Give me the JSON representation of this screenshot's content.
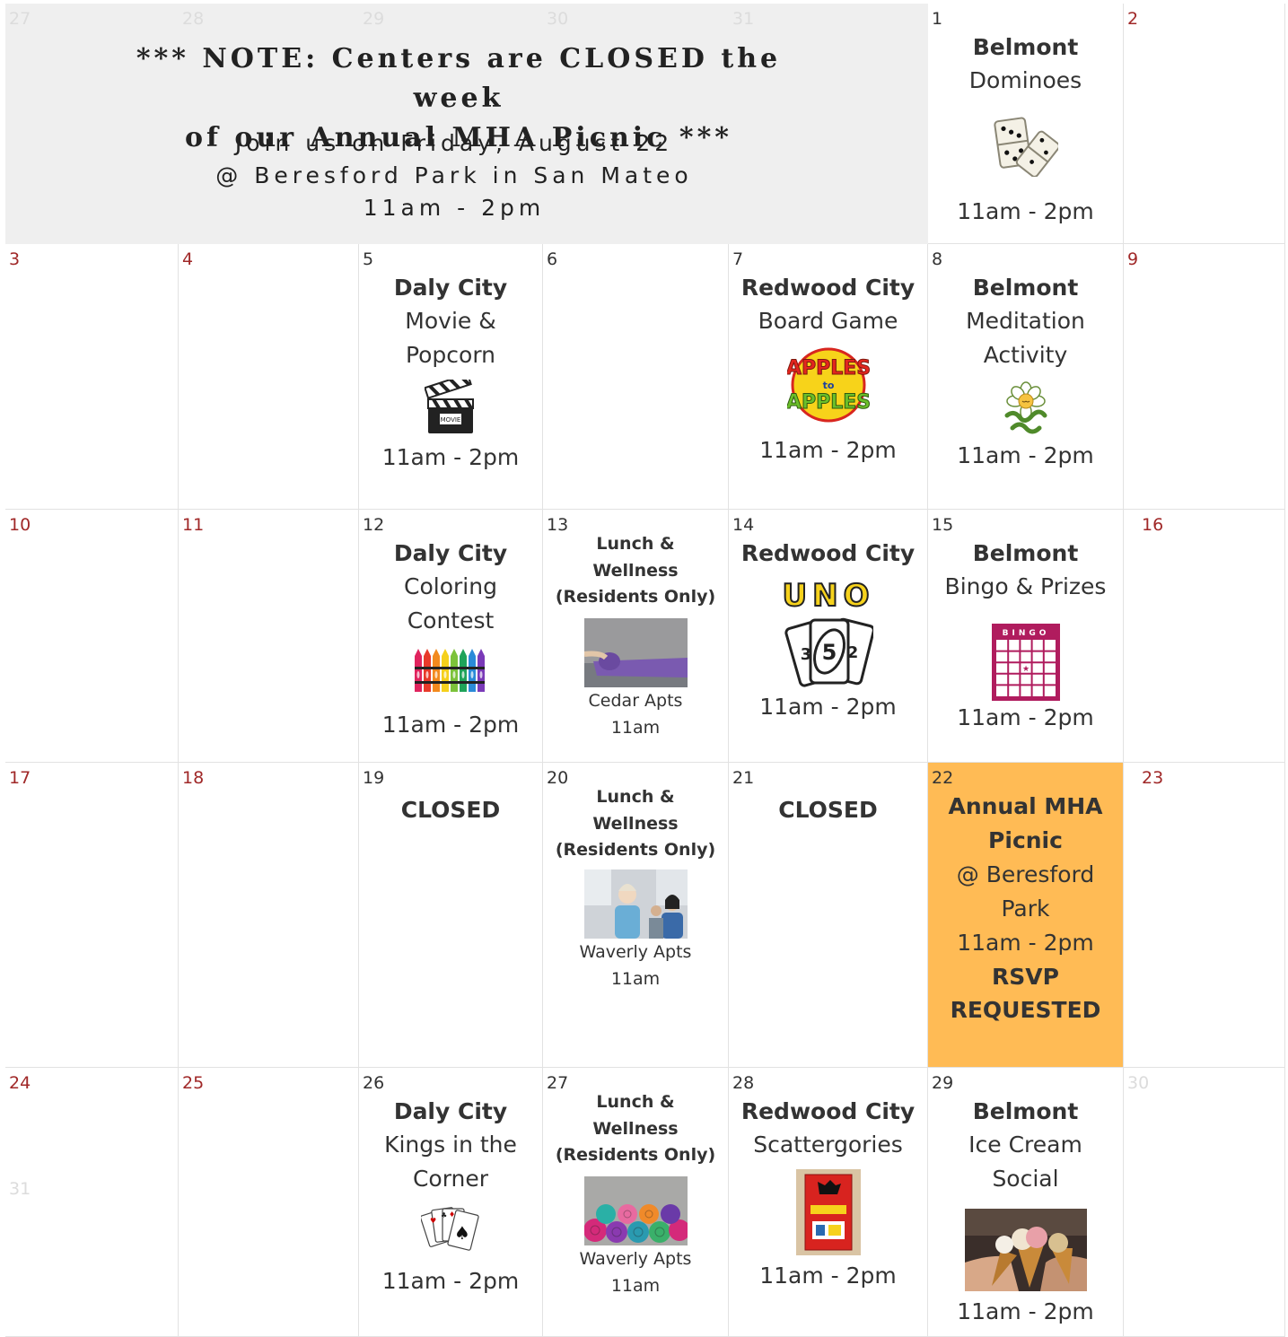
{
  "banner": {
    "note_line1": "*** NOTE: Centers are CLOSED the week",
    "note_line2": "of our Annual MHA Picnic ***",
    "join_line1": "Join us on Friday, August 22",
    "join_line2": "@ Beresford Park in San Mateo",
    "join_line3": "11am - 2pm"
  },
  "days": {
    "d27p": "27",
    "d28p": "28",
    "d29p": "29",
    "d30p": "30",
    "d31p": "31",
    "d1": "1",
    "d2": "2",
    "d3": "3",
    "d4": "4",
    "d5": "5",
    "d6": "6",
    "d7": "7",
    "d8": "8",
    "d9": "9",
    "d10": "10",
    "d11": "11",
    "d12": "12",
    "d13": "13",
    "d14": "14",
    "d15": "15",
    "d16": "16",
    "d17": "17",
    "d18": "18",
    "d19": "19",
    "d20": "20",
    "d21": "21",
    "d22": "22",
    "d23": "23",
    "d24": "24",
    "d25": "25",
    "d26": "26",
    "d27": "27",
    "d28": "28",
    "d29": "29",
    "d30": "30",
    "d31": "31"
  },
  "events": {
    "aug1": {
      "location": "Belmont",
      "activity": "Dominoes",
      "time": "11am - 2pm"
    },
    "aug5": {
      "location": "Daly City",
      "activity1": "Movie &",
      "activity2": "Popcorn",
      "time": "11am - 2pm"
    },
    "aug7": {
      "location": "Redwood City",
      "activity": "Board Game",
      "time": "11am - 2pm"
    },
    "aug8": {
      "location": "Belmont",
      "activity1": "Meditation",
      "activity2": "Activity",
      "time": "11am - 2pm"
    },
    "aug12": {
      "location": "Daly City",
      "activity1": "Coloring",
      "activity2": "Contest",
      "time": "11am - 2pm"
    },
    "aug13": {
      "title1": "Lunch &",
      "title2": "Wellness",
      "title3": "(Residents Only)",
      "place": "Cedar Apts",
      "time": "11am"
    },
    "aug14": {
      "location": "Redwood City",
      "time": "11am - 2pm"
    },
    "aug15": {
      "location": "Belmont",
      "activity": "Bingo & Prizes",
      "time": "11am - 2pm"
    },
    "aug19": {
      "closed": "CLOSED"
    },
    "aug20": {
      "title1": "Lunch &",
      "title2": "Wellness",
      "title3": "(Residents Only)",
      "place": "Waverly Apts",
      "time": "11am"
    },
    "aug21": {
      "closed": "CLOSED"
    },
    "aug22": {
      "title1": "Annual MHA",
      "title2": "Picnic",
      "place1": "@ Beresford",
      "place2": "Park",
      "time": "11am - 2pm",
      "rsvp1": "RSVP",
      "rsvp2": "REQUESTED"
    },
    "aug26": {
      "location": "Daly City",
      "activity1": "Kings in the",
      "activity2": "Corner",
      "time": "11am - 2pm"
    },
    "aug27": {
      "title1": "Lunch &",
      "title2": "Wellness",
      "title3": "(Residents Only)",
      "place": "Waverly Apts",
      "time": "11am"
    },
    "aug28": {
      "location": "Redwood City",
      "activity": "Scattergories",
      "time": "11am - 2pm"
    },
    "aug29": {
      "location": "Belmont",
      "activity1": "Ice Cream",
      "activity2": "Social",
      "time": "11am - 2pm"
    }
  },
  "images": {
    "uno_text": "UNO",
    "apples_top": "APPLES",
    "apples_mid": "to",
    "apples_bot": "APPLES",
    "bingo_header": "BINGO",
    "movie_label": "MOVIE"
  },
  "colors": {
    "weekend_number": "#a02828",
    "highlight": "#ffbb55",
    "banner_bg": "#efefef"
  }
}
